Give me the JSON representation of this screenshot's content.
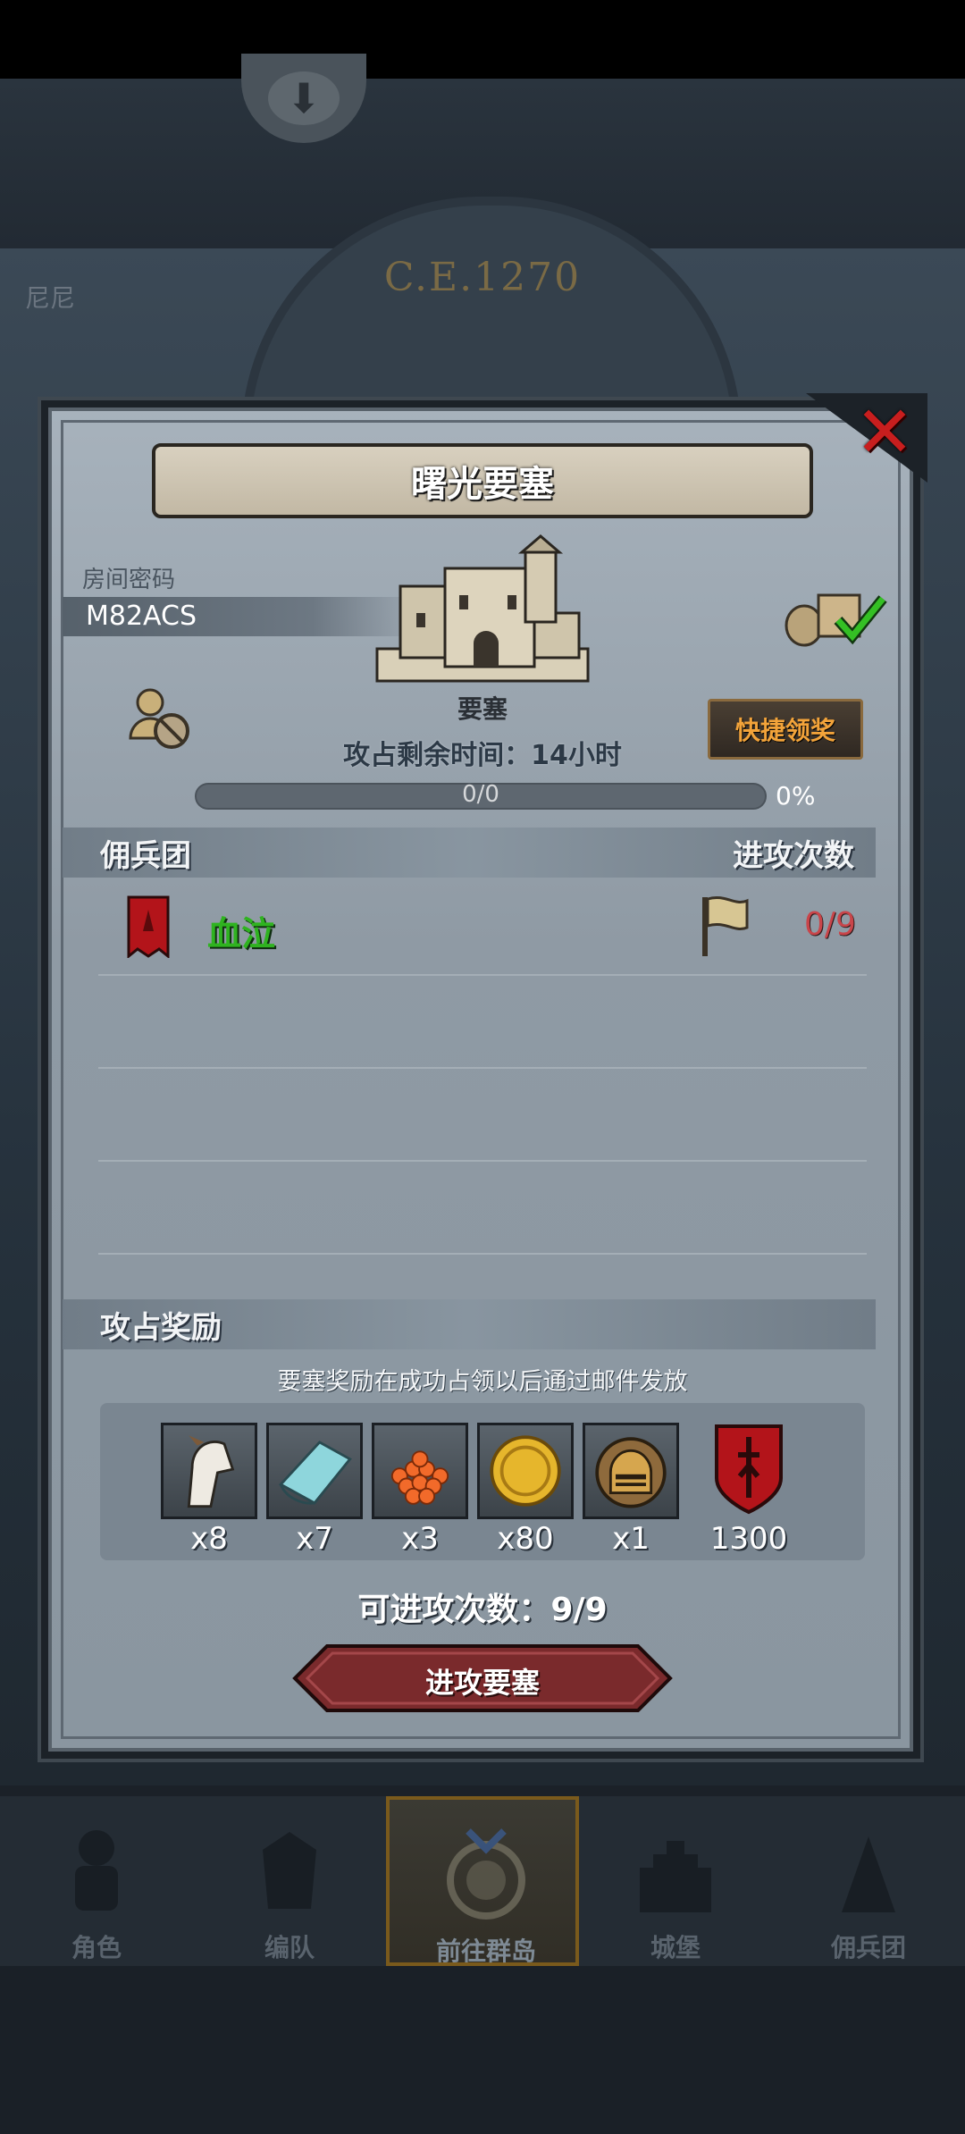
{
  "background": {
    "year": "C.E.1270",
    "left_text": "尼尼"
  },
  "dialog": {
    "title": "曙光要塞",
    "room_password_label": "房间密码",
    "room_password": "M82ACS",
    "fortress_name": "要塞",
    "quick_claim_label": "快捷领奖",
    "remaining_time": "攻占剩余时间：14小时",
    "progress_text": "0/0",
    "progress_percent": "0%",
    "progress_fraction": 0,
    "mercenary_header": "佣兵团",
    "attack_count_header": "进攻次数",
    "guild": {
      "name": "血泣",
      "attacks": "0/9"
    },
    "reward_header": "攻占奖励",
    "reward_note": "要塞奖励在成功占领以后通过邮件发放",
    "rewards": [
      {
        "icon": "horse-icon",
        "count": "x8"
      },
      {
        "icon": "cloth-icon",
        "count": "x7"
      },
      {
        "icon": "roe-icon",
        "count": "x3"
      },
      {
        "icon": "gold-coin-icon",
        "count": "x80"
      },
      {
        "icon": "helmet-icon",
        "count": "x1"
      },
      {
        "icon": "guild-shield-icon",
        "count": "1300"
      }
    ],
    "available_attacks": "可进攻次数：9/9",
    "attack_button_label": "进攻要塞"
  },
  "nav": {
    "items": [
      {
        "label": "角色",
        "icon": "knight-icon",
        "active": false
      },
      {
        "label": "编队",
        "icon": "armor-icon",
        "active": false
      },
      {
        "label": "前往群岛",
        "icon": "dragon-emblem-icon",
        "active": true
      },
      {
        "label": "城堡",
        "icon": "castle-icon",
        "active": false
      },
      {
        "label": "佣兵团",
        "icon": "mercenary-icon",
        "active": false
      }
    ]
  },
  "colors": {
    "guild_green": "#2fb320",
    "attack_red": "#c9454a",
    "quick_orange": "#f2a33a",
    "close_red": "#c81e1e"
  }
}
